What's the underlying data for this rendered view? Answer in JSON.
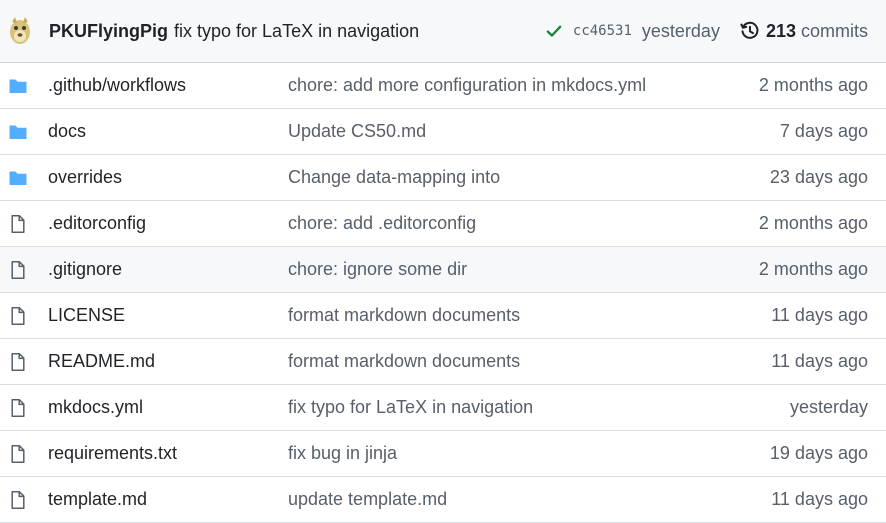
{
  "latest_commit": {
    "author": "PKUFlyingPig",
    "message": "fix typo for LaTeX in navigation",
    "status_icon": "check-icon",
    "status_color": "#1a7f37",
    "sha": "cc46531",
    "time": "yesterday",
    "history_icon": "history-icon",
    "commit_count": "213",
    "commits_label": "commits"
  },
  "colors": {
    "folder": "#54aeff",
    "file": "#57606a",
    "header_bg": "#f6f8fa",
    "border": "#d0d7de"
  },
  "files": [
    {
      "type": "folder",
      "name": ".github/workflows",
      "message": "chore: add more configuration in mkdocs.yml",
      "age": "2 months ago"
    },
    {
      "type": "folder",
      "name": "docs",
      "message": "Update CS50.md",
      "age": "7 days ago"
    },
    {
      "type": "folder",
      "name": "overrides",
      "message": "Change data-mapping into",
      "age": "23 days ago"
    },
    {
      "type": "file",
      "name": ".editorconfig",
      "message": "chore: add .editorconfig",
      "age": "2 months ago"
    },
    {
      "type": "file",
      "name": ".gitignore",
      "message": "chore: ignore some dir",
      "age": "2 months ago",
      "hover": true
    },
    {
      "type": "file",
      "name": "LICENSE",
      "message": "format markdown documents",
      "age": "11 days ago"
    },
    {
      "type": "file",
      "name": "README.md",
      "message": "format markdown documents",
      "age": "11 days ago"
    },
    {
      "type": "file",
      "name": "mkdocs.yml",
      "message": "fix typo for LaTeX in navigation",
      "age": "yesterday"
    },
    {
      "type": "file",
      "name": "requirements.txt",
      "message": "fix bug in jinja",
      "age": "19 days ago"
    },
    {
      "type": "file",
      "name": "template.md",
      "message": "update template.md",
      "age": "11 days ago"
    }
  ]
}
